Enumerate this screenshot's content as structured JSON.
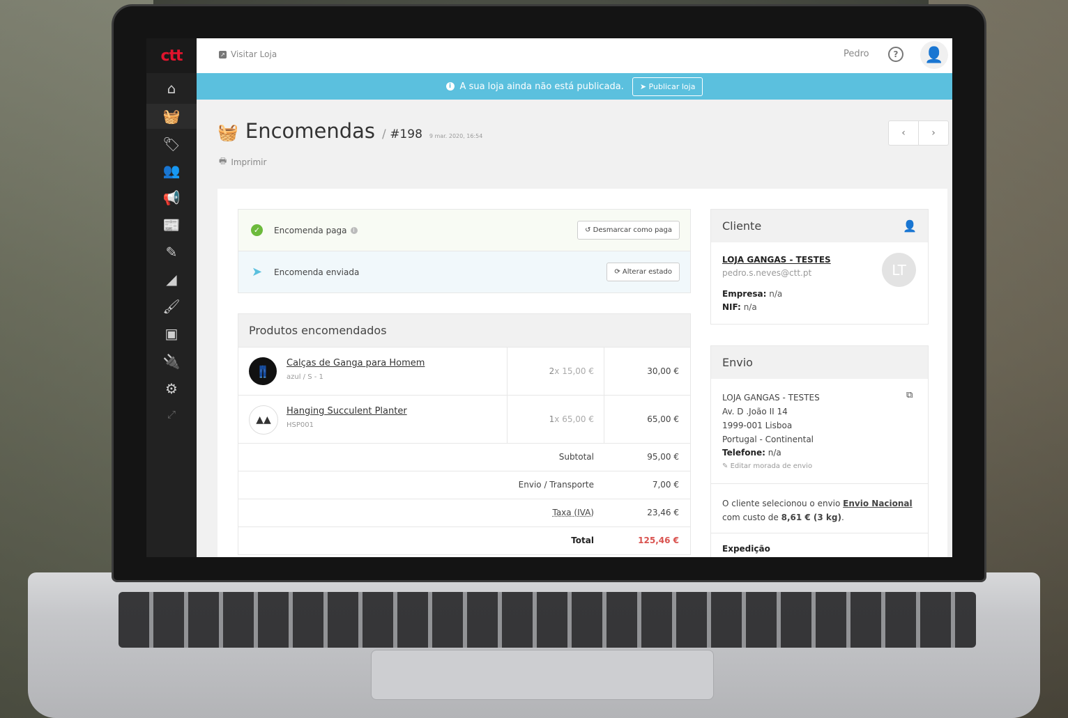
{
  "app": {
    "logo": "ctt"
  },
  "topbar": {
    "visit_store": "Visitar Loja",
    "user": "Pedro",
    "help": "?"
  },
  "notice": {
    "message": "A sua loja ainda não está publicada.",
    "publish_button": "Publicar loja",
    "info": "i"
  },
  "header": {
    "title": "Encomendas",
    "separator": "/",
    "order_number": "#198",
    "order_date": "9 mar. 2020, 16:54",
    "print": "Imprimir",
    "prev": "‹",
    "next": "›"
  },
  "status": {
    "paid_label": "Encomenda paga",
    "paid_info": "i",
    "unmark_button": "Desmarcar como paga",
    "sent_label": "Encomenda enviada",
    "change_state_button": "Alterar estado"
  },
  "products": {
    "heading": "Produtos encomendados",
    "items": [
      {
        "name": "Calças de Ganga para Homem",
        "sub": "azul / S - 1",
        "qty": "2",
        "unit": "x 15,00 €",
        "total": "30,00 €"
      },
      {
        "name": "Hanging Succulent Planter",
        "sub": "HSP001",
        "qty": "1",
        "unit": "x 65,00 €",
        "total": "65,00 €"
      }
    ],
    "summary": {
      "subtotal_label": "Subtotal",
      "subtotal": "95,00 €",
      "shipping_label": "Envio / Transporte",
      "shipping": "7,00 €",
      "tax_label": "Taxa (IVA)",
      "tax": "23,46 €",
      "total_label": "Total",
      "total": "125,46 €"
    }
  },
  "client": {
    "heading": "Cliente",
    "name": "LOJA GANGAS - TESTES",
    "email": "pedro.s.neves@ctt.pt",
    "initials": "LT",
    "company_label": "Empresa:",
    "company": "n/a",
    "nif_label": "NIF:",
    "nif": "n/a"
  },
  "shipping": {
    "heading": "Envio",
    "name": "LOJA GANGAS - TESTES",
    "street": "Av. D .João II 14",
    "postal": "1999-001 Lisboa",
    "country": "Portugal - Continental",
    "phone_label": "Telefone:",
    "phone": "n/a",
    "edit": "Editar morada de envio",
    "note_prefix": "O cliente selecionou o envio",
    "method": "Envio Nacional",
    "note_mid": "com custo de",
    "cost": "8,61 € (3 kg)",
    "note_end": ".",
    "expedition": "Expedição"
  },
  "colors": {
    "brand_red": "#e0142d",
    "info_blue": "#5bc0de",
    "success": "#6cba3c",
    "total_red": "#d9534f"
  }
}
